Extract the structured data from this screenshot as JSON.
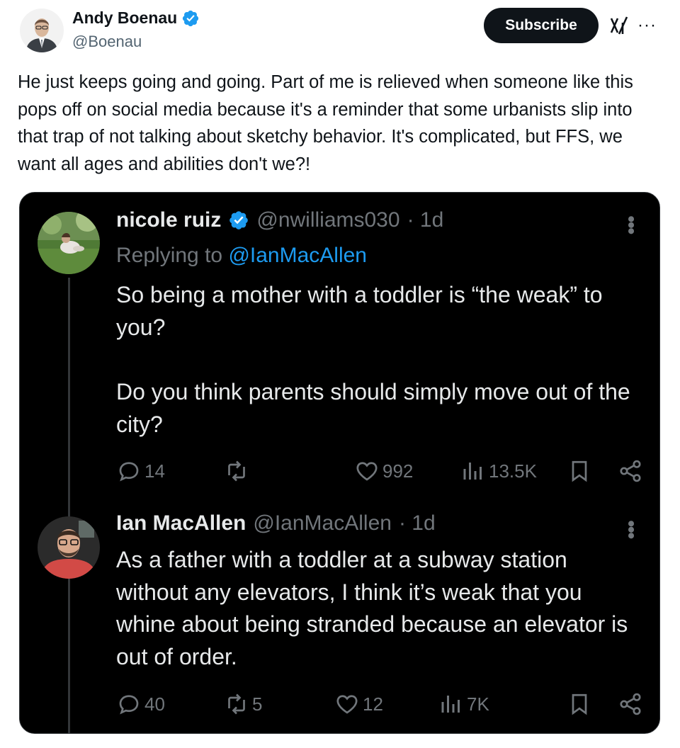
{
  "post": {
    "author_name": "Andy Boenau",
    "author_handle": "@Boenau",
    "subscribe_label": "Subscribe",
    "text": "He just keeps going and going. Part of me is relieved when someone like this pops off on social media because it's a reminder that some urbanists slip into that trap of not talking about sketchy behavior. It's complicated, but FFS, we want all ages and abilities don't we?!"
  },
  "embed": {
    "tweets": [
      {
        "name": "nicole ruiz",
        "handle": "@nwilliams030",
        "time": "· 1d",
        "replying_prefix": "Replying to ",
        "replying_to": "@IanMacAllen",
        "text_p1": "So being a mother with a toddler is “the weak” to you?",
        "text_p2": "Do you think parents should simply move out of the city?",
        "replies": "14",
        "reposts": "",
        "likes": "992",
        "views": "13.5K"
      },
      {
        "name": "Ian MacAllen",
        "handle": "@IanMacAllen",
        "time": "· 1d",
        "text_p1": "As a father with a toddler at a subway station without any elevators, I think it’s weak that you whine about being stranded because an elevator is out of order.",
        "replies": "40",
        "reposts": "5",
        "likes": "12",
        "views": "7K"
      }
    ]
  },
  "colors": {
    "verified": "#1d9bf0",
    "embed_bg": "#000000",
    "muted": "#71767b",
    "link": "#1d9bf0"
  },
  "icons": [
    "verified-icon",
    "grok-icon",
    "more-icon",
    "reply-icon",
    "repost-icon",
    "like-icon",
    "views-icon",
    "bookmark-icon",
    "share-icon"
  ]
}
